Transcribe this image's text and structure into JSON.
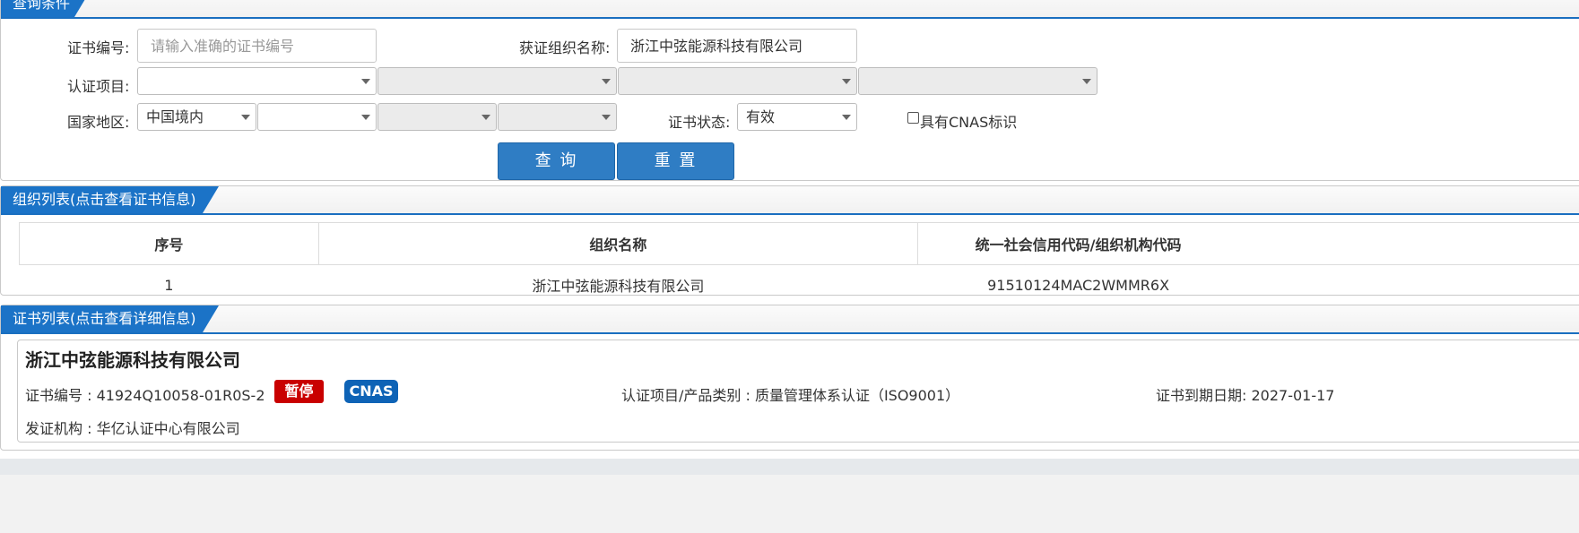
{
  "query": {
    "tab": "查询条件",
    "cert_no_label": "证书编号:",
    "cert_no_placeholder": "请输入准确的证书编号",
    "org_name_label": "获证组织名称:",
    "org_name_value": "浙江中弦能源科技有限公司",
    "cert_item_label": "认证项目:",
    "region_label": "国家地区:",
    "region_value": "中国境内",
    "status_label": "证书状态:",
    "status_value": "有效",
    "cnas_checkbox_label": "具有CNAS标识",
    "search_button": "查 询",
    "reset_button": "重 置"
  },
  "org_list": {
    "tab": "组织列表(点击查看证书信息)",
    "columns": [
      "序号",
      "组织名称",
      "统一社会信用代码/组织机构代码"
    ],
    "rows": [
      {
        "index": "1",
        "name": "浙江中弦能源科技有限公司",
        "code": "91510124MAC2WMMR6X"
      }
    ]
  },
  "cert_list": {
    "tab": "证书列表(点击查看详细信息)",
    "card": {
      "org_name": "浙江中弦能源科技有限公司",
      "cert_no": "证书编号 : 41924Q10058-01R0S-2",
      "status_badge": "暂停",
      "cnas_badge": "CNAS",
      "category": "认证项目/产品类别 : 质量管理体系认证（ISO9001）",
      "expiry": "证书到期日期: 2027-01-17",
      "issuer": "发证机构 : 华亿认证中心有限公司"
    }
  },
  "colors": {
    "accent": "#1b73c7",
    "button": "#2f7dc4",
    "badge_suspended": "#c90000",
    "badge_cnas": "#0e63b6"
  }
}
